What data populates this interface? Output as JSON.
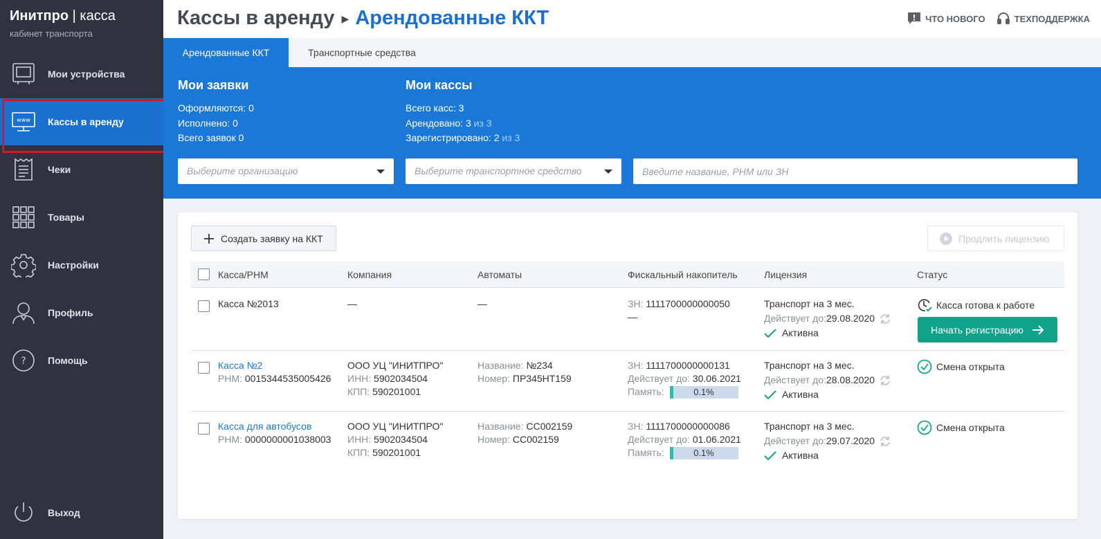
{
  "brand": {
    "name": "Инитпро",
    "product": "касса",
    "subtitle": "кабинет транспорта"
  },
  "sidebar": {
    "items": [
      {
        "label": "Мои устройства",
        "icon": "monitor-icon"
      },
      {
        "label": "Кассы в аренду",
        "icon": "www-terminal-icon",
        "active": true
      },
      {
        "label": "Чеки",
        "icon": "receipt-icon"
      },
      {
        "label": "Товары",
        "icon": "grid-icon"
      },
      {
        "label": "Настройки",
        "icon": "gear-icon"
      },
      {
        "label": "Профиль",
        "icon": "user-icon"
      },
      {
        "label": "Помощь",
        "icon": "help-circle-icon"
      }
    ],
    "logout": {
      "label": "Выход",
      "icon": "power-icon"
    }
  },
  "header": {
    "crumb_parent": "Кассы в аренду",
    "crumb_current": "Арендованные ККТ",
    "whats_new": "ЧТО НОВОГО",
    "support": "ТЕХПОДДЕРЖКА"
  },
  "tabs": [
    {
      "label": "Арендованные ККТ",
      "active": true
    },
    {
      "label": "Транспортные средства",
      "active": false
    }
  ],
  "summary": {
    "requests": {
      "title": "Мои заявки",
      "processing_label": "Оформляются:",
      "processing": "0",
      "done_label": "Исполнено:",
      "done": "0",
      "total_label": "Всего заявок",
      "total": "0"
    },
    "registers": {
      "title": "Мои кассы",
      "total_label": "Всего касс:",
      "total": "3",
      "rented_label": "Арендовано:",
      "rented": "3",
      "rented_of": "из 3",
      "registered_label": "Зарегистрировано:",
      "registered": "2",
      "registered_of": "из 3"
    }
  },
  "filters": {
    "organization_placeholder": "Выберите организацию",
    "vehicle_placeholder": "Выберите транспортное средство",
    "search_placeholder": "Введите название, РНМ или ЗН"
  },
  "actions": {
    "create": "Создать заявку на ККТ",
    "extend": "Продлить лицензию"
  },
  "table": {
    "columns": [
      "Касса/РНМ",
      "Компания",
      "Автоматы",
      "Фискальный накопитель",
      "Лицензия",
      "Статус"
    ],
    "rows": [
      {
        "name": "Касса №2013",
        "rnm_label": "",
        "rnm": "",
        "company": "—",
        "inn_label": "",
        "inn": "",
        "kpp_label": "",
        "kpp": "",
        "machine": "—",
        "machine_num_label": "",
        "machine_num": "",
        "fn_label": "ЗН:",
        "fn": "1111700000000050",
        "fn_valid_label": "",
        "fn_valid": "—",
        "memory_label": "",
        "memory": "",
        "license": "Транспорт на 3 мес.",
        "license_valid_label": "Действует до:",
        "license_valid": "29.08.2020",
        "license_status": "Активна",
        "status": "Касса готова к работе",
        "status_icon": "clock-check-icon",
        "action": "Начать регистрацию"
      },
      {
        "name": "Касса №2",
        "rnm_label": "РНМ:",
        "rnm": "0015344535005426",
        "company": "ООО УЦ \"ИНИТПРО\"",
        "inn_label": "ИНН:",
        "inn": "5902034504",
        "kpp_label": "КПП:",
        "kpp": "590201001",
        "machine_label": "Название:",
        "machine": "№234",
        "machine_num_label": "Номер:",
        "machine_num": "ПР345НТ159",
        "fn_label": "ЗН:",
        "fn": "1111700000000131",
        "fn_valid_label": "Действует до:",
        "fn_valid": "30.06.2021",
        "memory_label": "Память:",
        "memory": "0.1%",
        "memory_fraction": 0.001,
        "license": "Транспорт на 3 мес.",
        "license_valid_label": "Действует до:",
        "license_valid": "28.08.2020",
        "license_status": "Активна",
        "status": "Смена открыта",
        "status_icon": "check-circle-icon"
      },
      {
        "name": "Касса для автобусов",
        "rnm_label": "РНМ:",
        "rnm": "0000000001038003",
        "company": "ООО УЦ \"ИНИТПРО\"",
        "inn_label": "ИНН:",
        "inn": "5902034504",
        "kpp_label": "КПП:",
        "kpp": "590201001",
        "machine_label": "Название:",
        "machine": "СС002159",
        "machine_num_label": "Номер:",
        "machine_num": "СС002159",
        "fn_label": "ЗН:",
        "fn": "1111700000000086",
        "fn_valid_label": "Действует до:",
        "fn_valid": "01.06.2021",
        "memory_label": "Память:",
        "memory": "0.1%",
        "memory_fraction": 0.001,
        "license": "Транспорт на 3 мес.",
        "license_valid_label": "Действует до:",
        "license_valid": "29.07.2020",
        "license_status": "Активна",
        "status": "Смена открыта",
        "status_icon": "check-circle-icon"
      }
    ]
  },
  "colors": {
    "sidebar": "#2f3340",
    "accent": "#1b78d6",
    "success": "#10a389",
    "highlight": "#e0121e"
  }
}
